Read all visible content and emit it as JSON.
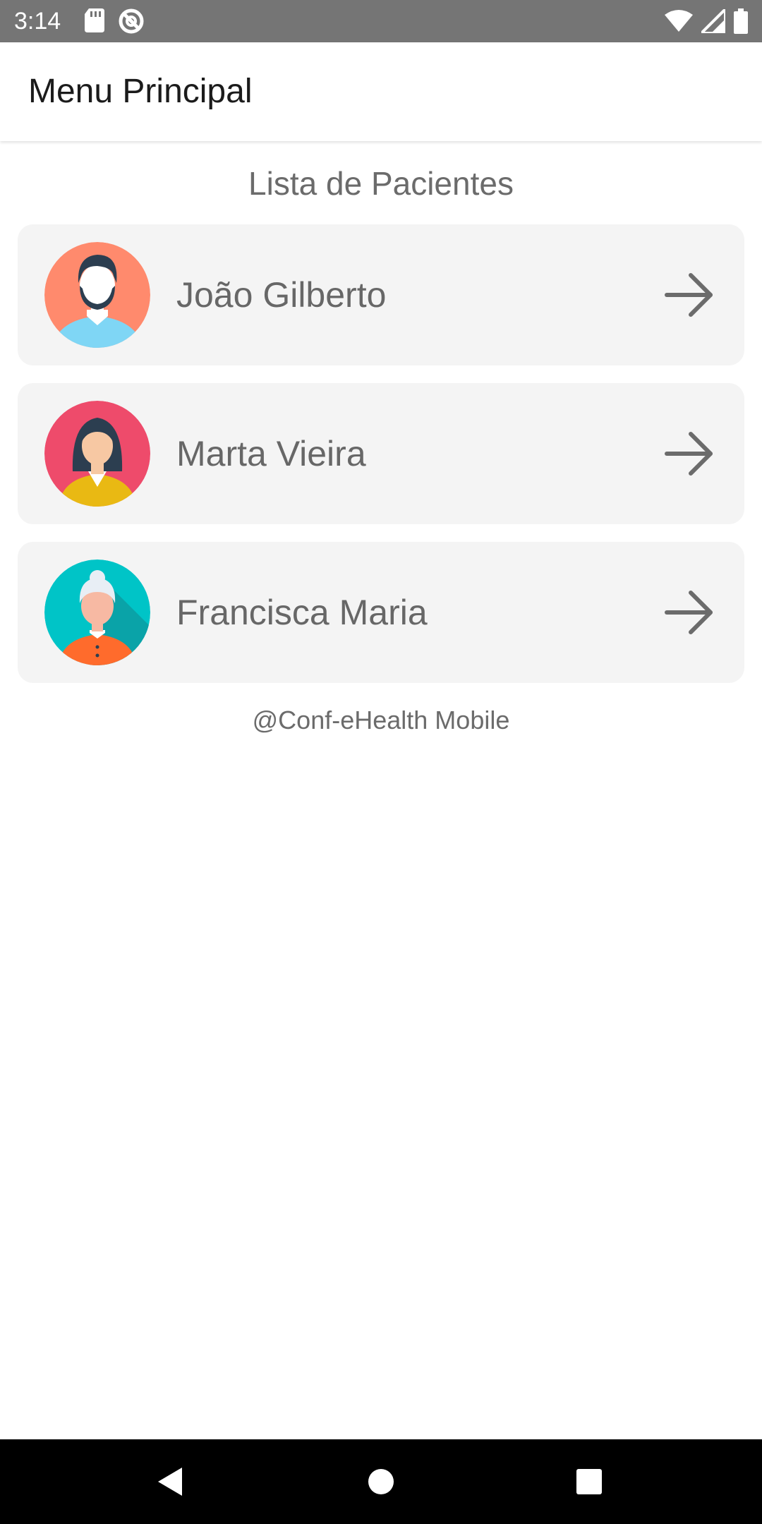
{
  "status_bar": {
    "time": "3:14",
    "left_icons": [
      "sd-card-icon",
      "do-not-disturb-icon"
    ],
    "right_icons": [
      "wifi-icon",
      "signal-icon",
      "battery-icon"
    ]
  },
  "app_bar": {
    "title": "Menu Principal"
  },
  "main": {
    "section_title": "Lista de Pacientes",
    "patients": [
      {
        "name": "João Gilberto",
        "avatar": "man-avatar-icon",
        "avatar_bg": "#FF8A6D"
      },
      {
        "name": "Marta Vieira",
        "avatar": "woman-avatar-icon",
        "avatar_bg": "#EE4B6B"
      },
      {
        "name": "Francisca Maria",
        "avatar": "elderly-woman-avatar-icon",
        "avatar_bg": "#00C4C7"
      }
    ],
    "footer": "@Conf-eHealth Mobile"
  },
  "nav_bar": {
    "buttons": [
      "back-icon",
      "home-icon",
      "recents-icon"
    ]
  }
}
